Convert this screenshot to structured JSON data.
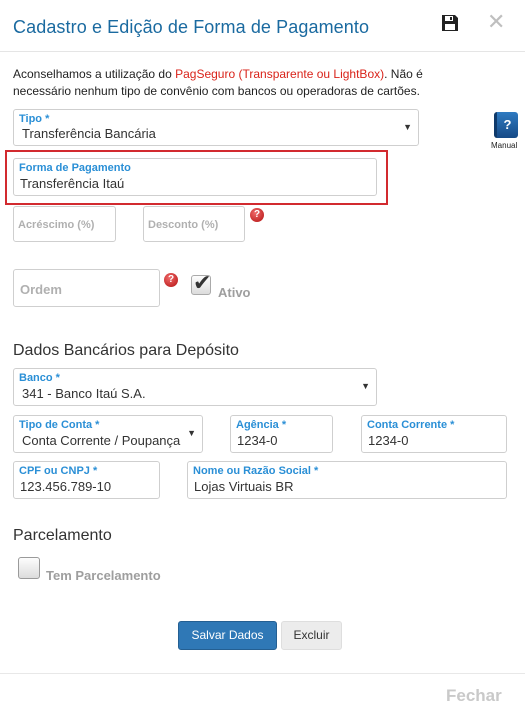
{
  "header": {
    "title": "Cadastro e Edição de Forma de Pagamento",
    "save_icon": "floppy-disk-icon",
    "close_icon": "close-icon",
    "close_glyph": "✕"
  },
  "notice": {
    "prefix": "Aconselhamos a utilização do ",
    "link": "PagSeguro (Transparente ou LightBox)",
    "suffix": ". Não é necessário nenhum tipo de convênio com bancos ou operadoras de cartões."
  },
  "tipo": {
    "label": "Tipo *",
    "value": "Transferência Bancária"
  },
  "manual": {
    "icon_glyph": "?",
    "label": "Manual"
  },
  "forma_pagamento": {
    "label": "Forma de Pagamento",
    "value": "Transferência Itaú"
  },
  "acrescimo": {
    "placeholder": "Acréscimo (%)"
  },
  "desconto": {
    "placeholder": "Desconto (%)"
  },
  "help_glyph": "?",
  "ordem": {
    "placeholder": "Ordem"
  },
  "ativo": {
    "label": "Ativo",
    "checked": true,
    "tick": "✔"
  },
  "dados_bancarios": {
    "heading": "Dados Bancários para Depósito",
    "banco": {
      "label": "Banco *",
      "value": "341 - Banco Itaú S.A."
    },
    "tipo_conta": {
      "label": "Tipo de Conta *",
      "value": "Conta Corrente / Poupança"
    },
    "agencia": {
      "label": "Agência *",
      "value": "1234-0"
    },
    "conta_corrente": {
      "label": "Conta Corrente *",
      "value": "1234-0"
    },
    "cpf_cnpj": {
      "label": "CPF ou CNPJ *",
      "value": "123.456.789-10"
    },
    "razao_social": {
      "label": "Nome ou Razão Social *",
      "value": "Lojas Virtuais BR"
    }
  },
  "parcelamento": {
    "heading": "Parcelamento",
    "tem_parcelamento": {
      "label": "Tem Parcelamento",
      "checked": false
    }
  },
  "actions": {
    "save": "Salvar Dados",
    "delete": "Excluir"
  },
  "footer": {
    "close": "Fechar"
  },
  "colors": {
    "title": "#1a6aa0",
    "label": "#2a8fd6",
    "primary": "#2f78b6",
    "highlight": "#d22a2f",
    "link": "#d9231a"
  }
}
